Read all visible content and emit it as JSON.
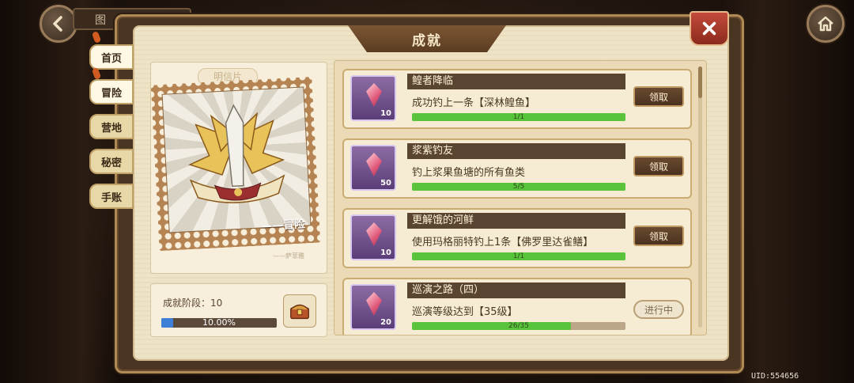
{
  "top_tab": {
    "label": "图"
  },
  "title": "成就",
  "side_tabs": [
    {
      "label": "首页"
    },
    {
      "label": "冒险"
    },
    {
      "label": "营地"
    },
    {
      "label": "秘密"
    },
    {
      "label": "手账"
    }
  ],
  "postcard": {
    "label": "明信片",
    "caption": "——冒险",
    "signature": "——萨菲雅"
  },
  "stage": {
    "label": "成就阶段：10",
    "progress_text": "10.00%",
    "progress_fraction": 0.1
  },
  "achievements": [
    {
      "title": "鳇者降临",
      "desc": "成功钓上一条【深林鳇鱼】",
      "progress": "1/1",
      "fraction": 1.0,
      "reward_count": "10",
      "button": "领取"
    },
    {
      "title": "浆紫钓友",
      "desc": "钓上浆果鱼塘的所有鱼类",
      "progress": "5/5",
      "fraction": 1.0,
      "reward_count": "50",
      "button": "领取"
    },
    {
      "title": "更解饿的河鲜",
      "desc": "使用玛格丽特钓上1条【佛罗里达雀鳝】",
      "progress": "1/1",
      "fraction": 1.0,
      "reward_count": "10",
      "button": "领取"
    },
    {
      "title": "巡演之路（四）",
      "desc": "巡演等级达到【35级】",
      "progress": "26/35",
      "fraction": 0.743,
      "reward_count": "20",
      "button": "进行中"
    }
  ],
  "uid": "UID:554656",
  "colors": {
    "progress_green": "#58c33b",
    "stage_blue": "#3e7fd8",
    "claim_brown": "#5a3e28"
  }
}
